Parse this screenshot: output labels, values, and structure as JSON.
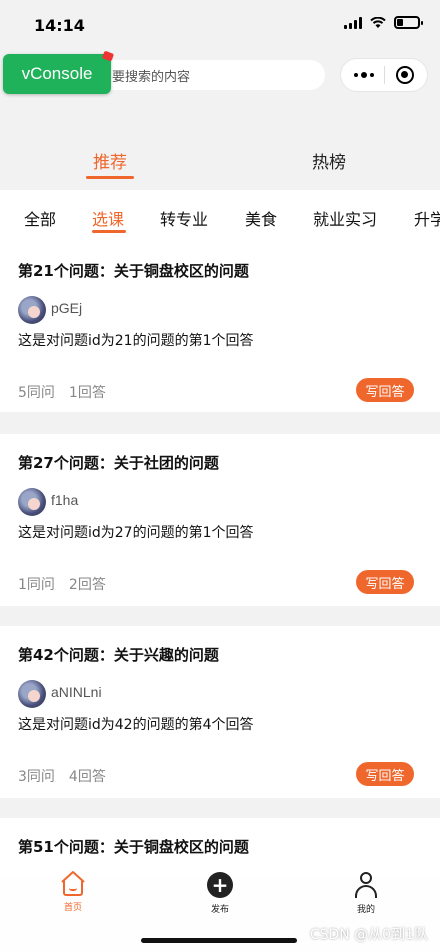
{
  "status_bar": {
    "time": "14:14"
  },
  "top_bar": {
    "vconsole_label": "vConsole",
    "search_placeholder": "要搜索的内容"
  },
  "main_tabs": [
    {
      "label": "推荐",
      "active": true
    },
    {
      "label": "热榜",
      "active": false
    }
  ],
  "category_tabs": [
    {
      "label": "全部",
      "active": false
    },
    {
      "label": "选课",
      "active": true
    },
    {
      "label": "转专业",
      "active": false
    },
    {
      "label": "美食",
      "active": false
    },
    {
      "label": "就业实习",
      "active": false
    },
    {
      "label": "升学",
      "active": false
    }
  ],
  "questions": [
    {
      "title": "第21个问题：关于铜盘校区的问题",
      "username": "pGEj",
      "answer": "这是对问题id为21的问题的第1个回答",
      "ask_count": "5同问",
      "answer_count": "1回答",
      "write_label": "写回答"
    },
    {
      "title": "第27个问题：关于社团的问题",
      "username": "f1ha",
      "answer": "这是对问题id为27的问题的第1个回答",
      "ask_count": "1同问",
      "answer_count": "2回答",
      "write_label": "写回答"
    },
    {
      "title": "第42个问题：关于兴趣的问题",
      "username": "aNINLni",
      "answer": "这是对问题id为42的问题的第4个回答",
      "ask_count": "3同问",
      "answer_count": "4回答",
      "write_label": "写回答"
    },
    {
      "title": "第51个问题：关于铜盘校区的问题"
    }
  ],
  "bottom_nav": [
    {
      "label": "首页",
      "icon": "home-icon",
      "active": true
    },
    {
      "label": "发布",
      "icon": "plus-circle-icon",
      "active": false
    },
    {
      "label": "我的",
      "icon": "user-icon",
      "active": false
    }
  ],
  "watermark": "CSDN @从0到1队",
  "colors": {
    "accent": "#f0672d",
    "vconsole": "#1fb25a"
  }
}
